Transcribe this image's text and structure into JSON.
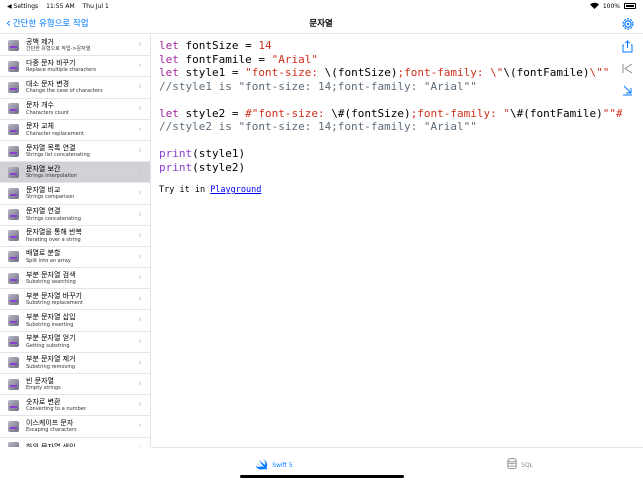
{
  "status_bar": {
    "back_app": "◀ Settings",
    "time": "11:55 AM",
    "date": "Thu Jul 1",
    "battery": "100%"
  },
  "nav": {
    "back_label": "간단한 유형으로 작업",
    "title": "문자열"
  },
  "sidebar": {
    "items": [
      {
        "title": "공백 제거",
        "subtitle": "간단한 유형으로 작업->문자열"
      },
      {
        "title": "다중 문자 바꾸기",
        "subtitle": "Replace multiple characters"
      },
      {
        "title": "대소 문자 변경",
        "subtitle": "Change the case of characters"
      },
      {
        "title": "문자 개수",
        "subtitle": "Characters count"
      },
      {
        "title": "문자 교체",
        "subtitle": "Character replacement"
      },
      {
        "title": "문자열 목록 연결",
        "subtitle": "Strings list concatenating"
      },
      {
        "title": "문자열 보간",
        "subtitle": "Strings interpolation"
      },
      {
        "title": "문자열 비교",
        "subtitle": "Strings comparison"
      },
      {
        "title": "문자열 연결",
        "subtitle": "Strings concatenating"
      },
      {
        "title": "문자열을 통해 반복",
        "subtitle": "Iterating over a string"
      },
      {
        "title": "배열로 분할",
        "subtitle": "Split into an array"
      },
      {
        "title": "부분 문자열 검색",
        "subtitle": "Substring searching"
      },
      {
        "title": "부분 문자열 바꾸기",
        "subtitle": "Substring replacement"
      },
      {
        "title": "부분 문자열 삽입",
        "subtitle": "Substring inserting"
      },
      {
        "title": "부분 문자열 얻기",
        "subtitle": "Getting substring"
      },
      {
        "title": "부분 문자열 제거",
        "subtitle": "Substring removing"
      },
      {
        "title": "빈 문자열",
        "subtitle": "Empty strings"
      },
      {
        "title": "숫자로 변환",
        "subtitle": "Converting to a number"
      },
      {
        "title": "이스케이프 문자",
        "subtitle": "Escaping characters"
      },
      {
        "title": "하위 문자열 색인",
        "subtitle": ""
      }
    ],
    "selected_index": 6
  },
  "code": {
    "l1": {
      "kw": "let",
      "plain": " fontSize = ",
      "num": "14"
    },
    "l2": {
      "kw": "let",
      "plain": " fontFamile = ",
      "str": "\"Arial\""
    },
    "l3": {
      "kw": "let",
      "plain": " style1 = ",
      "s1": "\"font-size: ",
      "i1": "\\(fontSize)",
      "s2": ";font-family: \\\"",
      "i2": "\\(fontFamile)",
      "s3": "\\\"\""
    },
    "l4": "//style1 is \"font-size: 14;font-family: \"Arial\"\"",
    "l5": {
      "kw": "let",
      "plain": " style2 = ",
      "s1": "#\"font-size: ",
      "i1": "\\#(fontSize)",
      "s2": ";font-family: \"",
      "i2": "\\#(fontFamile)",
      "s3": "\"\"#"
    },
    "l6": "//style2 is \"font-size: 14;font-family: \"Arial\"\"",
    "l7": {
      "fn": "print",
      "arg": "(style1)"
    },
    "l8": {
      "fn": "print",
      "arg": "(style2)"
    }
  },
  "try_it": {
    "prefix": "Try it in ",
    "link": "Playground"
  },
  "tabs": [
    {
      "label": "Swift 5",
      "icon": "swift-icon",
      "active": true
    },
    {
      "label": "SQL",
      "icon": "database-icon",
      "active": false
    }
  ],
  "accent_color": "#007aff"
}
